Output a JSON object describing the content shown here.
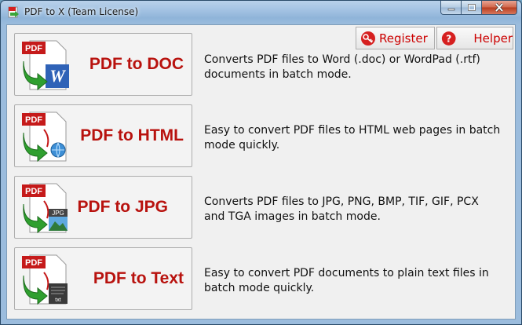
{
  "window": {
    "title": "PDF to X (Team License)",
    "controls": {
      "minimize": "minimize-icon",
      "maximize": "maximize-icon",
      "close": "close-icon"
    }
  },
  "header_buttons": {
    "register": "Register",
    "helper": "Helper"
  },
  "converters": [
    {
      "label": "PDF to DOC",
      "icon": "pdf-to-doc-icon",
      "description": "Converts PDF files to Word (.doc) or WordPad (.rtf) documents in batch mode."
    },
    {
      "label": "PDF to HTML",
      "icon": "pdf-to-html-icon",
      "description": "Easy to convert PDF files to HTML web pages in batch mode quickly."
    },
    {
      "label": "PDF to JPG",
      "icon": "pdf-to-jpg-icon",
      "description": "Converts PDF files to JPG, PNG, BMP, TIF, GIF, PCX and TGA images in batch mode."
    },
    {
      "label": "PDF to Text",
      "icon": "pdf-to-text-icon",
      "description": "Easy to convert PDF documents to plain text files in batch mode quickly."
    }
  ],
  "icon_badges": {
    "pdf": "PDF",
    "jpg": "JPG",
    "txt": "txt"
  },
  "colors": {
    "label_red": "#b8120e",
    "header_button_text": "#cc0000",
    "client_bg": "#f0f0f0"
  }
}
